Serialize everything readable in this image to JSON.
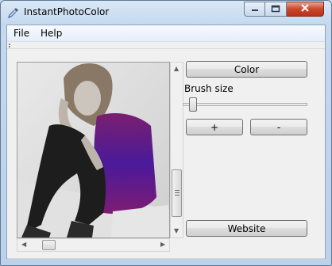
{
  "window": {
    "title": "InstantPhotoColor"
  },
  "menu": {
    "file": "File",
    "help": "Help"
  },
  "controls": {
    "color_button": "Color",
    "brush_size_label": "Brush size",
    "plus_button": "+",
    "minus_button": "-",
    "website_button": "Website"
  },
  "icons": {
    "app": "eyedropper-icon",
    "minimize": "minimize-icon",
    "maximize": "maximize-icon",
    "close": "close-icon"
  },
  "colors": {
    "close_button": "#c9462c",
    "title_bar": "#c4d8ee"
  }
}
